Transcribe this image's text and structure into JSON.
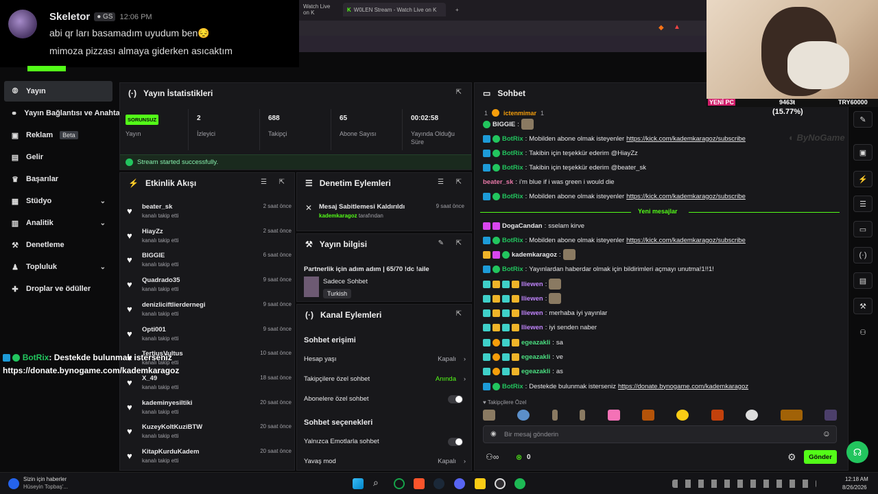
{
  "overlay": {
    "username": "Skeletor",
    "tag": "GS",
    "time": "12:06 PM",
    "line1": "abi qr ları basamadım uyudum ben😔",
    "line2": "mimoza pizzası almaya giderken asıcaktım"
  },
  "browser": {
    "tab1": "Watch Live on K",
    "tab2": "W0LEN Stream - Watch Live on K",
    "new_tab": "+"
  },
  "sidenav": {
    "items": [
      {
        "label": "Yayın",
        "icon": "broadcast-icon"
      },
      {
        "label": "Yayın Bağlantısı ve Anahtarı",
        "icon": "link-icon"
      },
      {
        "label": "Reklam",
        "icon": "ad-icon",
        "badge": "Beta"
      },
      {
        "label": "Gelir",
        "icon": "revenue-icon"
      },
      {
        "label": "Başarılar",
        "icon": "trophy-icon"
      },
      {
        "label": "Stüdyo",
        "icon": "studio-icon",
        "chevron": "⌄"
      },
      {
        "label": "Analitik",
        "icon": "chart-icon",
        "chevron": "⌄"
      },
      {
        "label": "Denetleme",
        "icon": "hammer-icon"
      },
      {
        "label": "Topluluk",
        "icon": "community-icon",
        "chevron": "⌄"
      },
      {
        "label": "Droplar ve ödüller",
        "icon": "gift-icon"
      }
    ]
  },
  "stats": {
    "title": "Yayın İstatistikleri",
    "status_badge": "SORUNSUZ",
    "status_label": "Yayın",
    "viewers_value": "2",
    "viewers_label": "İzleyici",
    "followers_value": "688",
    "followers_label": "Takipçi",
    "subs_value": "65",
    "subs_label": "Abone Sayısı",
    "duration_value": "00:02:58",
    "duration_label": "Yayında Olduğu Süre",
    "success_message": "Stream started successfully."
  },
  "activity": {
    "title": "Etkinlik Akışı",
    "items": [
      {
        "name": "beater_sk",
        "sub": "kanalı takip etti",
        "time": "2 saat önce"
      },
      {
        "name": "HiayZz",
        "sub": "kanalı takip etti",
        "time": "2 saat önce"
      },
      {
        "name": "BIGGIE",
        "sub": "kanalı takip etti",
        "time": "6 saat önce"
      },
      {
        "name": "Quadrado35",
        "sub": "kanalı takip etti",
        "time": "9 saat önce"
      },
      {
        "name": "denizliciftlierdernegi",
        "sub": "kanalı takip etti",
        "time": "9 saat önce"
      },
      {
        "name": "Opti001",
        "sub": "kanalı takip etti",
        "time": "9 saat önce"
      },
      {
        "name": "TertiusVultus",
        "sub": "kanalı takip etti",
        "time": "10 saat önce"
      },
      {
        "name": "X_49",
        "sub": "kanalı takip etti",
        "time": "18 saat önce"
      },
      {
        "name": "kademinyesiltiki",
        "sub": "kanalı takip etti",
        "time": "20 saat önce"
      },
      {
        "name": "KuzeyKoltKuziBTW",
        "sub": "kanalı takip etti",
        "time": "20 saat önce"
      },
      {
        "name": "KitapKurduKadem",
        "sub": "kanalı takip etti",
        "time": "20 saat önce"
      }
    ]
  },
  "moderation": {
    "title": "Denetim Eylemleri",
    "action": "Mesaj Sabitlemesi Kaldırıldı",
    "time": "9 saat önce",
    "actor": "kademkaragoz",
    "actor_suffix": "tarafından"
  },
  "stream_info": {
    "title": "Yayın bilgisi",
    "stream_title": "Partnerlik için adım adım | 65/70 !dc !aile",
    "category": "Sadece Sohbet",
    "language": "Turkish"
  },
  "channel_actions": {
    "title": "Kanal Eylemleri",
    "section1": "Sohbet erişimi",
    "account_age": "Hesap yaşı",
    "account_age_value": "Kapalı",
    "followers_only": "Takipçilere özel sohbet",
    "followers_only_value": "Anında",
    "subs_only": "Abonelere özel sohbet",
    "section2": "Sohbet seçenekleri",
    "emote_only": "Yalnızca Emotlarla sohbet",
    "slow_mode": "Yavaş mod",
    "slow_mode_value": "Kapalı"
  },
  "chat": {
    "title": "Sohbet",
    "pinned_rank": "1",
    "pinned_user": "ictenmimar",
    "pinned_count": "1",
    "new_messages": "Yeni mesajlar",
    "followers_only_label": "Takipçilere Özel",
    "input_placeholder": "Bir mesaj gönderin",
    "points": "0",
    "send": "Gönder",
    "messages": [
      {
        "user": "BIGGIE",
        "color": "#e8e8ea",
        "text": ""
      },
      {
        "user": "BotRix",
        "color": "#22c55e",
        "text": "Mobilden abone olmak isteyenler ",
        "link": "https://kick.com/kademkaragoz/subscribe"
      },
      {
        "user": "BotRix",
        "color": "#22c55e",
        "text": "Takibin için teşekkür ederim @HiayZz"
      },
      {
        "user": "BotRix",
        "color": "#22c55e",
        "text": "Takibin için teşekkür ederim @beater_sk"
      },
      {
        "user": "beater_sk",
        "color": "#e879a8",
        "text": "i'm blue if i was green i would die"
      },
      {
        "user": "BotRix",
        "color": "#22c55e",
        "text": "Mobilden abone olmak isteyenler ",
        "link": "https://kick.com/kademkaragoz/subscribe"
      },
      {
        "user": "DogaCandan",
        "color": "#e8e8ea",
        "text": "sselam kirve"
      },
      {
        "user": "BotRix",
        "color": "#22c55e",
        "text": "Mobilden abone olmak isteyenler ",
        "link": "https://kick.com/kademkaragoz/subscribe"
      },
      {
        "user": "kademkaragoz",
        "color": "#e8e8ea",
        "text": ""
      },
      {
        "user": "BotRix",
        "color": "#22c55e",
        "text": "Yayınlardan haberdar olmak için bildirimleri açmayı unutma!1!!1!"
      },
      {
        "user": "lliewen",
        "color": "#c084fc",
        "text": ""
      },
      {
        "user": "lliewen",
        "color": "#c084fc",
        "text": ""
      },
      {
        "user": "lliewen",
        "color": "#c084fc",
        "text": "merhaba iyi yayınlar"
      },
      {
        "user": "lliewen",
        "color": "#c084fc",
        "text": "iyi senden naber"
      },
      {
        "user": "egeazakli",
        "color": "#4ade80",
        "text": "sa"
      },
      {
        "user": "egeazakli",
        "color": "#4ade80",
        "text": "ve"
      },
      {
        "user": "egeazakli",
        "color": "#4ade80",
        "text": "as"
      },
      {
        "user": "BotRix",
        "color": "#22c55e",
        "text": "Destekde bulunmak isterseniz ",
        "link": "https://donate.bynogame.com/kademkaragoz"
      }
    ]
  },
  "stream_overlay": {
    "botrix_user": "BotRix",
    "botrix_text": ": Destekde bulunmak isterseniz",
    "botrix_link": "https://donate.bynogame.com/kademkaragoz",
    "yeni_pc": "YENİ PC",
    "amount": "9463ŧ",
    "percent": "(15.77%)",
    "goal": "TRY60000",
    "brand": "ByNoGame"
  },
  "taskbar": {
    "news_title": "Sizin için haberler",
    "news_sub": "Hüseyin Topbaş'...",
    "time": "12:18 AM",
    "date": "8/26/2026"
  }
}
